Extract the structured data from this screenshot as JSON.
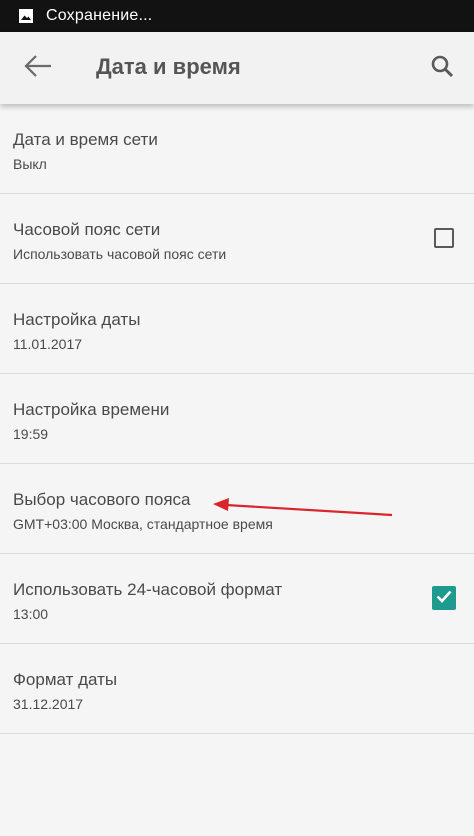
{
  "status_bar": {
    "text": "Сохранение...",
    "icon": "image-icon"
  },
  "app_bar": {
    "title": "Дата и время",
    "back_icon": "arrow-back-icon",
    "search_icon": "search-icon"
  },
  "settings": [
    {
      "title": "Дата и время сети",
      "summary": "Выкл"
    },
    {
      "title": "Часовой пояс сети",
      "summary": "Использовать часовой пояс сети",
      "checkbox": false
    },
    {
      "title": "Настройка даты",
      "summary": "11.01.2017"
    },
    {
      "title": "Настройка времени",
      "summary": "19:59"
    },
    {
      "title": "Выбор часового пояса",
      "summary": "GMT+03:00 Москва, стандартное время"
    },
    {
      "title": "Использовать 24-часовой формат",
      "summary": "13:00",
      "checkbox": true
    },
    {
      "title": "Формат даты",
      "summary": "31.12.2017"
    }
  ],
  "colors": {
    "accent": "#1f9a8e",
    "annotation_arrow": "#d9262b",
    "status_bar": "#121212"
  }
}
